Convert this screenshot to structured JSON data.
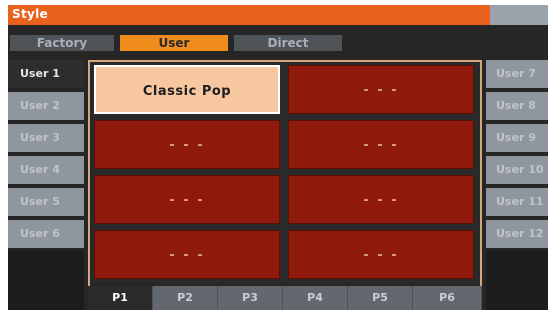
{
  "title": "Style",
  "tabs": [
    {
      "label": "Factory",
      "active": false
    },
    {
      "label": "User",
      "active": true
    },
    {
      "label": "Direct",
      "active": false
    }
  ],
  "left_banks": [
    {
      "label": "User 1",
      "selected": true
    },
    {
      "label": "User 2",
      "selected": false
    },
    {
      "label": "User 3",
      "selected": false
    },
    {
      "label": "User 4",
      "selected": false
    },
    {
      "label": "User 5",
      "selected": false
    },
    {
      "label": "User 6",
      "selected": false
    }
  ],
  "right_banks": [
    {
      "label": "User 7"
    },
    {
      "label": "User 8"
    },
    {
      "label": "User 9"
    },
    {
      "label": "User 10"
    },
    {
      "label": "User 11"
    },
    {
      "label": "User 12"
    }
  ],
  "slots": [
    {
      "label": "Classic Pop",
      "selected": true
    },
    {
      "label": "- - -",
      "selected": false
    },
    {
      "label": "- - -",
      "selected": false
    },
    {
      "label": "- - -",
      "selected": false
    },
    {
      "label": "- - -",
      "selected": false
    },
    {
      "label": "- - -",
      "selected": false
    },
    {
      "label": "- - -",
      "selected": false
    },
    {
      "label": "- - -",
      "selected": false
    }
  ],
  "pages": [
    {
      "label": "P1",
      "active": true
    },
    {
      "label": "P2",
      "active": false
    },
    {
      "label": "P3",
      "active": false
    },
    {
      "label": "P4",
      "active": false
    },
    {
      "label": "P5",
      "active": false
    },
    {
      "label": "P6",
      "active": false
    }
  ],
  "colors": {
    "title_bar": "#e8621e",
    "active_tab": "#f08c1c",
    "slot": "#8f1a0c",
    "slot_selected": "#f7c7a0"
  }
}
